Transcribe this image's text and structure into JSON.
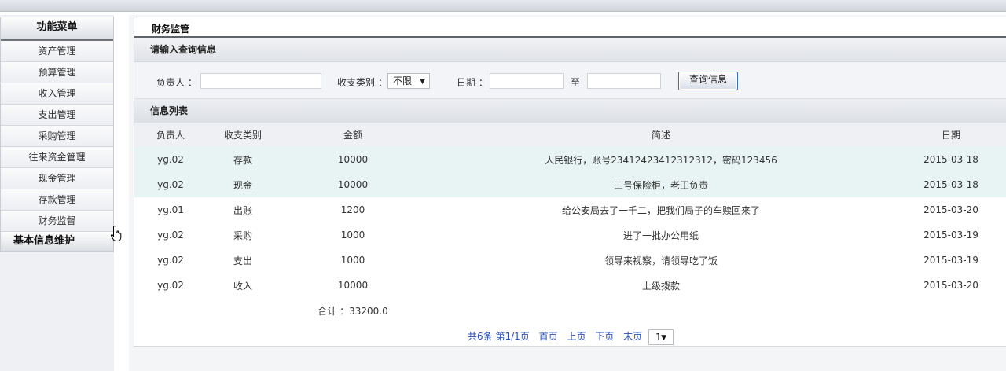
{
  "sidebar": {
    "header": "功能菜单",
    "items": [
      "资产管理",
      "预算管理",
      "收入管理",
      "支出管理",
      "采购管理",
      "往来资金管理",
      "现金管理",
      "存款管理",
      "财务监督"
    ],
    "section2": "基本信息维护"
  },
  "main": {
    "title": "财务监管",
    "search": {
      "header": "请输入查询信息",
      "owner_label": "负责人 ：",
      "owner_value": "",
      "type_label": "收支类别 ：",
      "type_value": "不限",
      "date_label": "日期 ：",
      "date_from": "",
      "date_sep": "至",
      "date_to": "",
      "button": "查询信息"
    },
    "list": {
      "header": "信息列表",
      "columns": [
        "负责人",
        "收支类别",
        "金额",
        "简述",
        "日期"
      ],
      "rows": [
        [
          "yg.02",
          "存款",
          "10000",
          "人民银行，账号23412423412312312，密码123456",
          "2015-03-18"
        ],
        [
          "yg.02",
          "现金",
          "10000",
          "三号保险柜，老王负责",
          "2015-03-18"
        ],
        [
          "yg.01",
          "出账",
          "1200",
          "给公安局去了一千二，把我们局子的车赎回来了",
          "2015-03-20"
        ],
        [
          "yg.02",
          "采购",
          "1000",
          "进了一批办公用纸",
          "2015-03-19"
        ],
        [
          "yg.02",
          "支出",
          "1000",
          "领导来视察，请领导吃了饭",
          "2015-03-19"
        ],
        [
          "yg.02",
          "收入",
          "10000",
          "上级拨款",
          "2015-03-20"
        ]
      ],
      "total": "合计 ：33200.0"
    },
    "pager": {
      "summary": "共6条 第1/1页",
      "first": "首页",
      "prev": "上页",
      "next": "下页",
      "last": "末页",
      "page_value": "1"
    }
  },
  "icons": {
    "cursor": "hand-pointer-icon",
    "dropdown": "chevron-down-icon"
  }
}
